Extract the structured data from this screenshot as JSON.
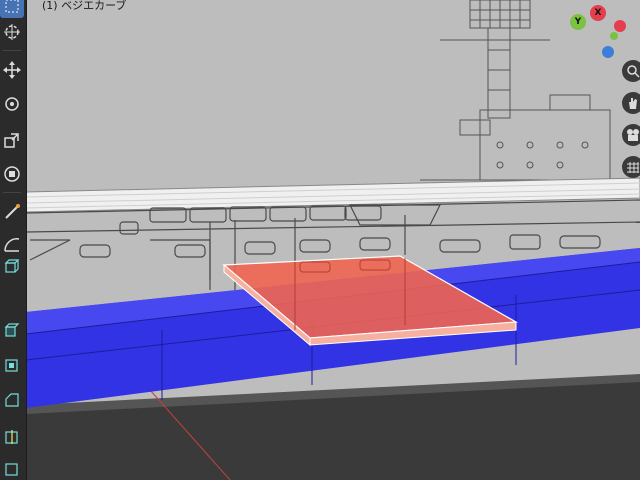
{
  "viewport": {
    "object_label": "(1) ベジエカーブ"
  },
  "gizmo": {
    "x_label": "X",
    "y_label": "Y"
  },
  "toolbar": {
    "tools": [
      "select-box-icon",
      "cursor-icon",
      "move-icon",
      "rotate-icon",
      "scale-icon",
      "transform-icon",
      "annotate-icon",
      "measure-icon",
      "add-cube-icon",
      "extrude-icon",
      "inset-icon",
      "bevel-icon",
      "loop-cut-icon",
      "knife-icon"
    ]
  },
  "nav": {
    "buttons": [
      "zoom-icon",
      "pan-hand-icon",
      "camera-icon",
      "grid-icon"
    ]
  },
  "colors": {
    "background_image": "#b9b9b9",
    "deck": "#3a3a3a",
    "blue_plate": "#3333e6",
    "red_plate": "#f06450",
    "active_tool": "#4772b3",
    "x_axis": "#e53e4d",
    "y_axis": "#7bc142",
    "z_axis": "#3b7fd6"
  }
}
